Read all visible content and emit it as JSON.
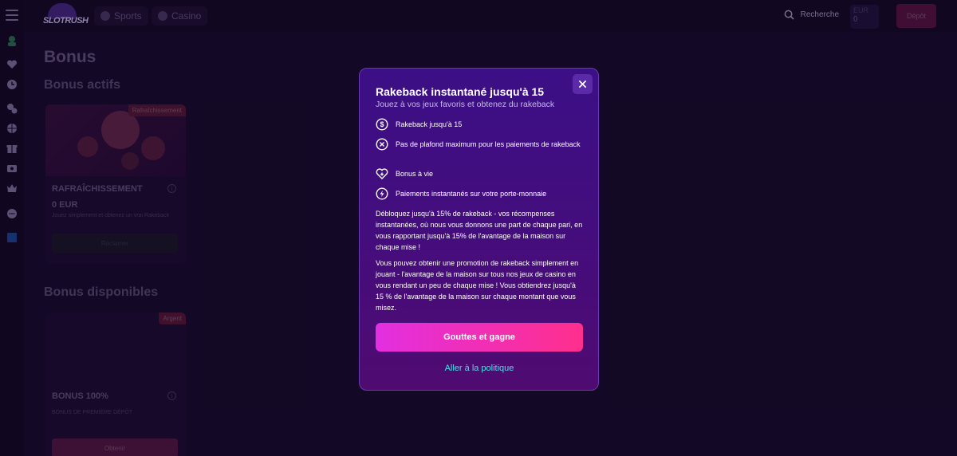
{
  "header": {
    "logo_text": "SLOTRUSH",
    "nav": [
      {
        "label": "Sports"
      },
      {
        "label": "Casino"
      }
    ],
    "search_label": "Recherche",
    "balance": {
      "currency": "EUR",
      "amount": "0"
    },
    "deposit_label": "Dépôt"
  },
  "sidebar": {
    "icons": [
      "menu-icon",
      "avatar-icon",
      "heart-icon",
      "clock-icon",
      "chips-icon",
      "ball-icon",
      "gift-icon",
      "ticket-icon",
      "crown-icon",
      "chat-icon",
      "flag-icon"
    ]
  },
  "page": {
    "title": "Bonus",
    "active_section": "Bonus actifs",
    "available_section": "Bonus disponibles"
  },
  "active_card": {
    "badge": "Rafraîchissement",
    "title": "RAFRAÎCHISSEMENT",
    "amount": "0 EUR",
    "desc": "Jouez simplement et obtenez un vrai Rakeback",
    "button": "Réclamer"
  },
  "available_card": {
    "badge": "Argent",
    "title": "BONUS 100%",
    "desc": "BONUS DE PREMIÈRE DÉPÔT",
    "button": "Obtenir"
  },
  "modal": {
    "title": "Rakeback instantané jusqu'à 15",
    "subtitle": "Jouez à vos jeux favoris et obtenez du rakeback",
    "features": [
      {
        "icon": "dollar-circle-icon",
        "text": "Rakeback jusqu'à 15"
      },
      {
        "icon": "no-limit-icon",
        "text": "Pas de plafond maximum pour les paiements de rakeback"
      },
      {
        "icon": "heart-plus-icon",
        "text": "Bonus à vie"
      },
      {
        "icon": "instant-payment-icon",
        "text": "Paiements instantanés sur votre porte-monnaie"
      }
    ],
    "paragraph1": "Débloquez jusqu'à 15% de rakeback - vos récompenses instantanées, où nous vous donnons une part de chaque pari, en vous rapportant jusqu'à 15% de l'avantage de la maison sur chaque mise !",
    "paragraph2": "Vous pouvez obtenir une promotion de rakeback simplement en jouant - l'avantage de la maison sur tous nos jeux de casino en vous rendant un peu de chaque mise ! Vous obtiendrez jusqu'à 15 % de l'avantage de la maison sur chaque montant que vous misez.",
    "cta_label": "Gouttes et gagne",
    "link_label": "Aller à la politique",
    "close_icon": "close-icon"
  },
  "colors": {
    "cta_start": "#e22fe0",
    "cta_end": "#ff2f8c",
    "link": "#4ee0e8",
    "modal_bg": "#3b0f86"
  }
}
